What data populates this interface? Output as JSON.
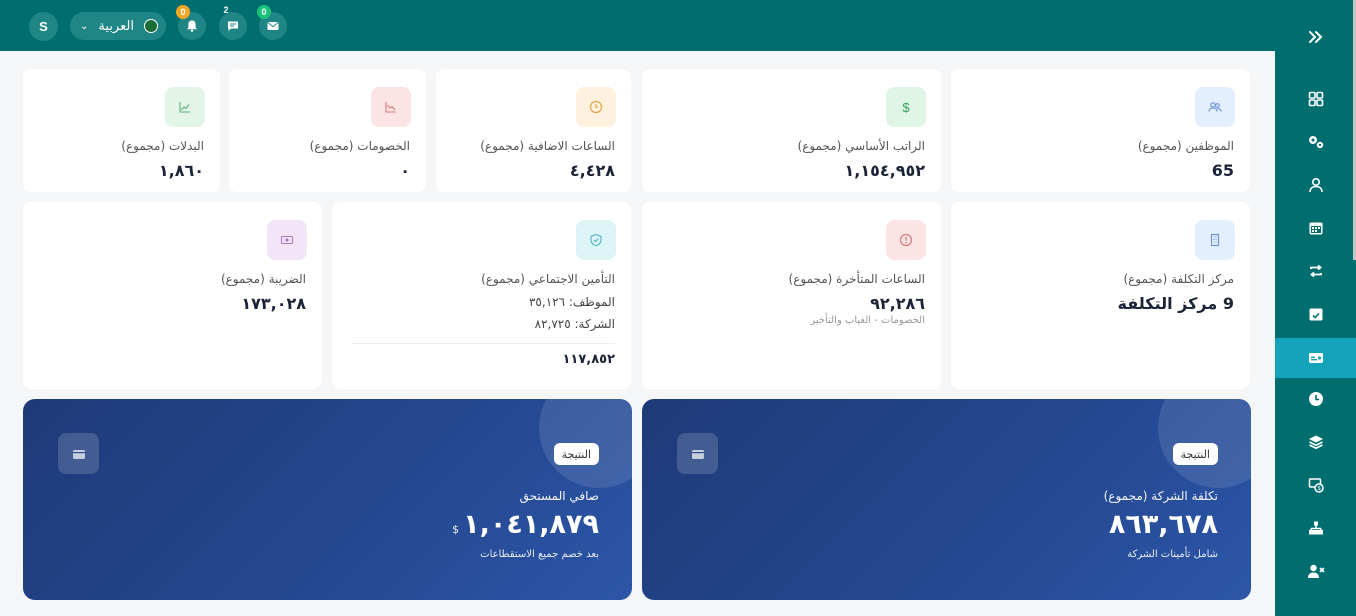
{
  "topbar": {
    "avatar_letter": "S",
    "language": "العربية",
    "notifications": {
      "bell": "0",
      "chat": "2",
      "mail": "0"
    },
    "icons": [
      "chevron-down-icon",
      "bell-icon",
      "chat-icon",
      "mail-icon"
    ]
  },
  "sidebar": {
    "items": [
      "dashboard-icon",
      "settings-icon",
      "user-icon",
      "calendar-icon",
      "transfer-icon",
      "calendar-check-icon",
      "payroll-icon",
      "clock-icon",
      "layers-icon",
      "money-icon",
      "org-icon",
      "user-remove-icon"
    ],
    "active_index": 6
  },
  "cards": {
    "employees": {
      "label": "الموظفين (مجموع)",
      "value": "65"
    },
    "basic_salary": {
      "label": "الراتب الأساسي (مجموع)",
      "value": "١,١٥٤,٩٥٢"
    },
    "overtime": {
      "label": "الساعات الاضافية (مجموع)",
      "value": "٤,٤٢٨"
    },
    "deductions": {
      "label": "الخصومات (مجموع)",
      "value": "٠"
    },
    "allowances": {
      "label": "البدلات (مجموع)",
      "value": "١,٨٦٠"
    },
    "cost_center": {
      "label": "مركز التكلفة (مجموع)",
      "value": "9 مركز التكلفة"
    },
    "late_hours": {
      "label": "الساعات المتأخرة (مجموع)",
      "value": "٩٢,٢٨٦",
      "sub": "الخصومات - الغياب والتأخير"
    },
    "social_insurance": {
      "label": "التأمين الاجتماعي (مجموع)",
      "employee_line": "الموظف: ٣٥,١٢٦",
      "company_line": "الشركة: ٨٢,٧٢٥",
      "total": "١١٧,٨٥٢"
    },
    "tax": {
      "label": "الضريبة (مجموع)",
      "value": "١٧٣,٠٢٨"
    }
  },
  "results": {
    "company_cost": {
      "pill": "النتيجة",
      "label": "تكلفة الشركة (مجموع)",
      "value": "٨٦٣,٦٧٨",
      "sub": "شامل تأمينات الشركة"
    },
    "net_due": {
      "pill": "النتيجة",
      "label": "صافي المستحق",
      "value": "١,٠٤١,٨٧٩",
      "unit": "$",
      "sub": "بعد خصم جميع الاستقطاعات"
    }
  },
  "colors": {
    "teal": "#006e6e",
    "active": "#14a3b8",
    "navy": "#24478f"
  }
}
